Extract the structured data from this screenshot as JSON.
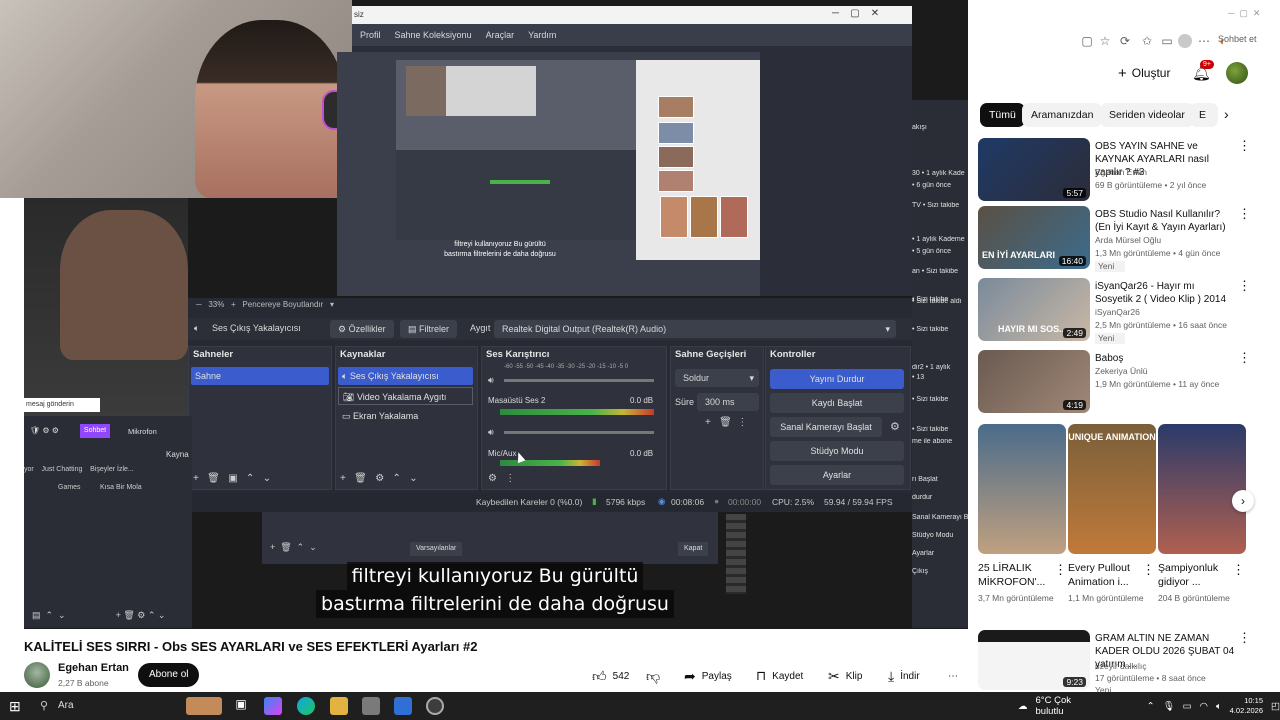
{
  "browser": {
    "chat_tab": "Sohbet et",
    "follow_label": "Oluştur",
    "notif_count": "9+"
  },
  "chips": [
    "Tümü",
    "Aramanızdan",
    "Seriden videolar",
    "E"
  ],
  "obs": {
    "menu": [
      "Profil",
      "Sahne Koleksiyonu",
      "Araçlar",
      "Yardım"
    ],
    "title_tail": "siz",
    "zoom": "33%",
    "zoom_mode": "Pencereye Boyutlandır",
    "preview_subtitle_1": "filtreyi kullanıyoruz Bu gürültü",
    "preview_subtitle_2": "bastırma filtrelerini de daha doğrusu",
    "source_label": "Ses Çıkış Yakalayıcısı",
    "properties": "Özellikler",
    "filters": "Filtreler",
    "device_label": "Aygıt",
    "device_value": "Realtek Digital Output (Realtek(R) Audio)",
    "docks": {
      "scenes": {
        "title": "Sahneler",
        "items": [
          "Sahne"
        ]
      },
      "sources": {
        "title": "Kaynaklar",
        "items": [
          "Ses Çıkış Yakalayıcısı",
          "Video Yakalama Aygıtı",
          "Ekran Yakalama"
        ]
      },
      "mixer": {
        "title": "Ses Karıştırıcı",
        "tracks": [
          {
            "name": "Masaüstü Ses 2",
            "db": "0.0 dB"
          },
          {
            "name": "Mic/Aux",
            "db": "0.0 dB"
          }
        ],
        "scale": "-60 -55 -50 -45 -40 -35 -30 -25 -20 -15 -10 -5 0"
      },
      "transitions": {
        "title": "Sahne Geçişleri",
        "type": "Soldur",
        "duration_label": "Süre",
        "duration": "300 ms"
      },
      "controls": {
        "title": "Kontroller",
        "buttons": [
          "Yayını Durdur",
          "Kaydı Başlat",
          "Sanal Kamerayı Başlat",
          "Stüdyo Modu",
          "Ayarlar"
        ]
      }
    },
    "status": {
      "dropped": "Kaybedilen Kareler 0 (%0.0)",
      "bitrate": "5796 kbps",
      "live_time": "00:08:06",
      "rec_time": "00:00:00",
      "cpu": "CPU: 2.5%",
      "fps": "59.94 / 59.94 FPS"
    },
    "lower_left": {
      "chat_label": "mesaj gönderin",
      "sohbet": "Sohbet",
      "mic": "Mikrofon",
      "kaynak": "Kayna",
      "tabs": [
        "yor",
        "Just Chatting",
        "Bişeyler İzle...",
        "Games",
        "Kısa Bir Mola"
      ]
    },
    "lower_mid": {
      "defaults": "Varsayılanlar",
      "close": "Kapat"
    },
    "right_strip": [
      "akışı",
      "30 • 1 aylık Kade",
      "• 6 gün önce",
      "TV • Sizi takibe",
      "• 1 aylık Kademe",
      "• 5 gün önce",
      "an • Sizi takibe",
      "• Sizi takibe",
      "• Sizi takibe aldı",
      "• Sizi takibe",
      "dir2 • 1 aylık",
      "• 13",
      "• Sizi takibe",
      "• Sizi takibe",
      "me ile abone",
      "rı Başlat",
      "durdur",
      "Sanal Kamerayı Başlat",
      "Stüdyo Modu",
      "Ayarlar",
      "Çıkış"
    ]
  },
  "caption": {
    "line1": "filtreyi kullanıyoruz Bu gürültü",
    "line2": "bastırma filtrelerini de daha doğrusu"
  },
  "video": {
    "title": "KALİTELİ SES SIRRI - Obs SES AYARLARI ve SES EFEKTLERİ Ayarları #2",
    "channel": "Egehan Ertan",
    "subscribers": "2,27 B abone",
    "subscribe": "Abone ol",
    "likes": "542",
    "share": "Paylaş",
    "save": "Kaydet",
    "clip": "Klip",
    "download": "İndir"
  },
  "recommendations": [
    {
      "title": "OBS YAYIN SAHNE ve KAYNAK AYARLARI nasıl yapılır ? #3",
      "channel": "Egehan Ertan",
      "meta": "69 B görüntüleme • 2 yıl önce",
      "duration": "5:57"
    },
    {
      "title": "OBS Studio Nasıl Kullanılır? (En İyi Kayıt & Yayın Ayarları)",
      "channel": "Arda Mürsel Oğlu",
      "meta": "1,3 Mn görüntüleme • 4 gün önce",
      "badge": "Yeni",
      "duration": "16:40"
    },
    {
      "title": "iSyanQar26 - Hayır mı Sosyetik 2 ( Video Klip ) 2014",
      "channel": "iSyanQar26",
      "meta": "2,5 Mn görüntüleme • 16 saat önce",
      "badge": "Yeni",
      "duration": "2:49"
    },
    {
      "title": "Baboş",
      "channel": "Zekeriya Ünlü",
      "meta": "1,9 Mn görüntüleme • 11 ay önce",
      "duration": "4:19"
    }
  ],
  "shorts": [
    {
      "title": "25 LİRALIK MİKROFON'...",
      "views": "3,7 Mn görüntüleme"
    },
    {
      "title": "Every Pullout Animation i...",
      "views": "1,1 Mn görüntüleme",
      "overlay": "UNIQUE ANIMATION"
    },
    {
      "title": "Şampiyonluk gidiyor ...",
      "views": "204 B görüntüleme"
    }
  ],
  "rec5": {
    "title": "GRAM ALTIN NE ZAMAN KADER OLDU 2026 ŞUBAT 04 yatırım ...",
    "channel": "üzeyir dalkılıç",
    "meta": "17 görüntüleme • 8 saat önce",
    "badge": "Yeni",
    "duration": "9:23"
  },
  "taskbar": {
    "search": "Ara",
    "weather": "6°C  Çok bulutlu",
    "time": "10:15",
    "date": "4.02.2026"
  }
}
